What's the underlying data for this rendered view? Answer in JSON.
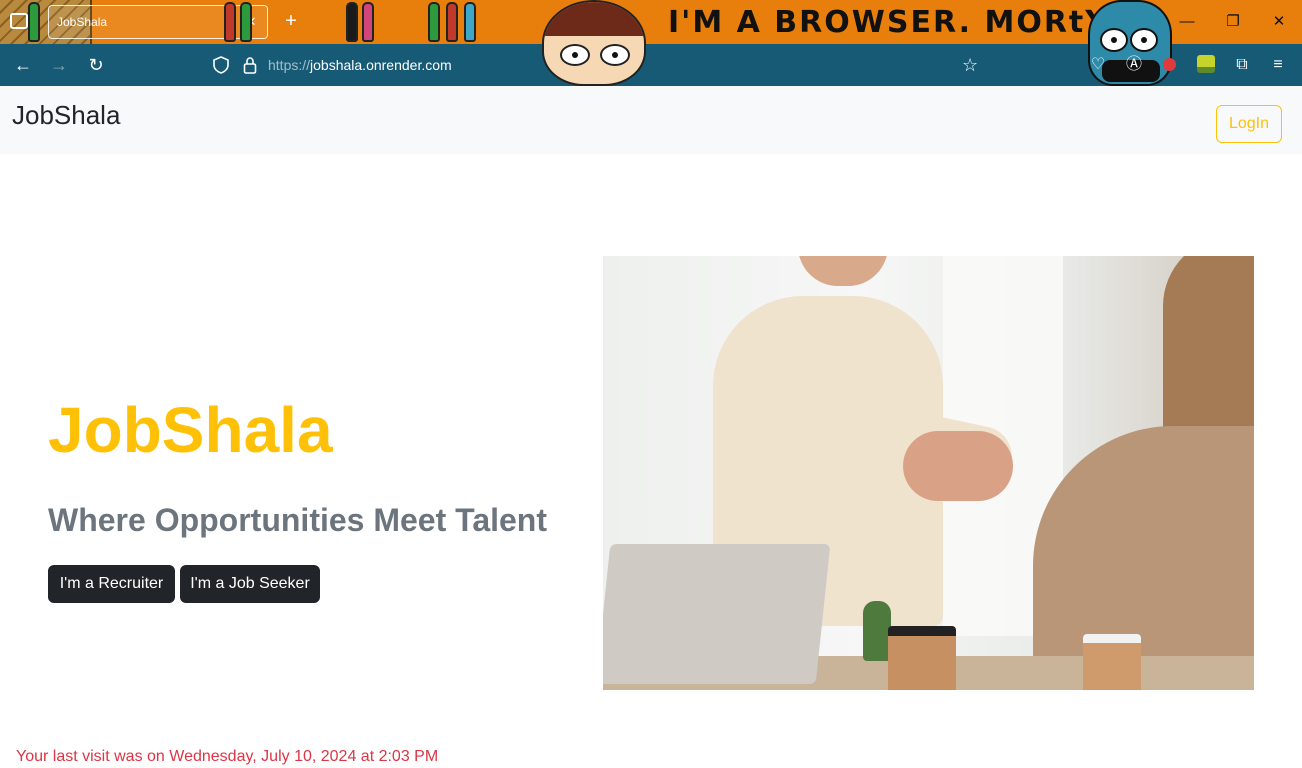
{
  "browser": {
    "tab_title": "JobShala",
    "tab_close": "✕",
    "new_tab": "+",
    "theme_banner": "I'M A BROWSER. MORtY!!!",
    "url_scheme": "https://",
    "url_host": "jobshala.onrender.com",
    "window_controls": {
      "minimize": "—",
      "restore": "❐",
      "close": "✕"
    },
    "icons": {
      "back": "arrow-left-icon",
      "forward": "arrow-right-icon",
      "reload": "reload-icon",
      "shield": "shield-icon",
      "lock": "lock-icon",
      "bookmark": "star-icon",
      "pocket": "pocket-icon",
      "account": "account-icon",
      "extensions": "puzzle-icon",
      "menu": "hamburger-menu-icon"
    },
    "colors": {
      "tabstrip": "#e87f0c",
      "toolbar": "#175a76"
    }
  },
  "site": {
    "brand": "JobShala",
    "login_label": "LogIn",
    "hero": {
      "title": "JobShala",
      "subtitle": "Where Opportunities Meet Talent",
      "recruiter_button": "I'm a Recruiter",
      "seeker_button": "I'm a Job Seeker",
      "image_subject": "handshake-photo"
    },
    "last_visit": "Your last visit was on Wednesday, July 10, 2024 at 2:03 PM",
    "colors": {
      "accent": "#ffc107",
      "subtitle": "#6c757d",
      "dark_button": "#212529",
      "notice": "#dc3545",
      "nav_bg": "#f8f9fa"
    }
  }
}
